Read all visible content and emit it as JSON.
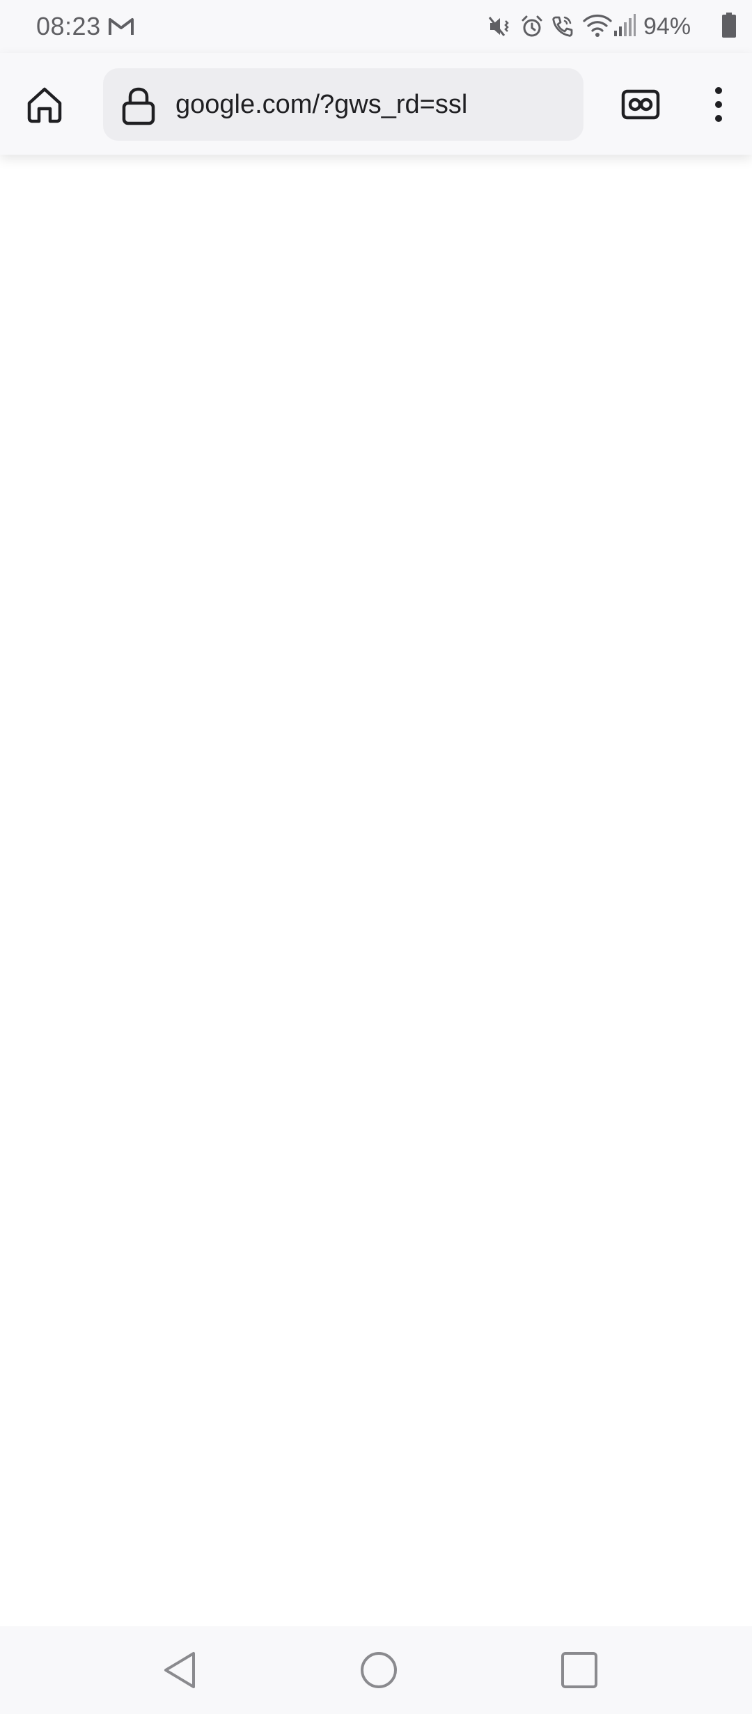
{
  "status_bar": {
    "time": "08:23",
    "battery_percent": "94%",
    "icons": [
      "gmail-icon",
      "mute-vibrate-icon",
      "alarm-icon",
      "wifi-calling-icon",
      "wifi-icon",
      "cell-signal-icon",
      "battery-icon"
    ]
  },
  "toolbar": {
    "url": "google.com/?gws_rd=ssl",
    "icons": [
      "home-icon",
      "lock-icon",
      "tracking-protection-icon",
      "overflow-menu-icon"
    ]
  },
  "nav_bar": {
    "icons": [
      "back-icon",
      "home-circle-icon",
      "recents-icon"
    ]
  },
  "colors": {
    "chrome_bg": "#f8f8fa",
    "url_bar_bg": "#ededf0",
    "text_primary": "#1f1f22",
    "status_text": "#5f5f63",
    "nav_icon": "#8a8a8e"
  }
}
